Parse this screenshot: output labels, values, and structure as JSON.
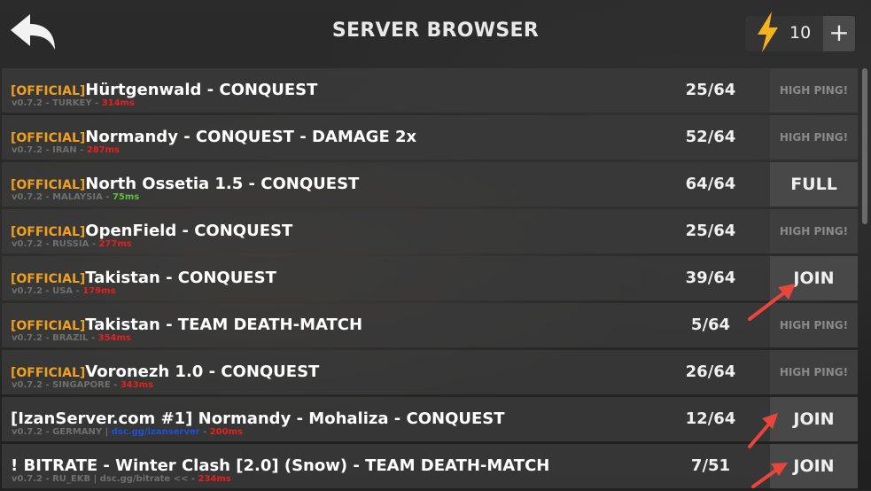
{
  "header": {
    "title": "SERVER BROWSER",
    "energy_count": "10",
    "plus_label": "+",
    "back_icon": "back-arrow-icon",
    "energy_icon": "lightning-bolt-icon"
  },
  "colors": {
    "official_tag": "#f0a020",
    "ping_red": "#e52020",
    "ping_green": "#5cc23a",
    "link_blue": "#1f4fd8"
  },
  "servers": [
    {
      "tag": "[OFFICIAL]",
      "name": "Hürtgenwald - CONQUEST",
      "meta": "v0.7.2 - TURKEY - ",
      "link": "",
      "link_suffix": "",
      "ping": "314ms",
      "ping_color": "#e52020",
      "players": "25/64",
      "action": "HIGH PING!",
      "action_type": "high"
    },
    {
      "tag": "[OFFICIAL]",
      "name": "Normandy - CONQUEST - DAMAGE 2x",
      "meta": "v0.7.2 - IRAN - ",
      "link": "",
      "link_suffix": "",
      "ping": "287ms",
      "ping_color": "#e52020",
      "players": "52/64",
      "action": "HIGH PING!",
      "action_type": "high"
    },
    {
      "tag": "[OFFICIAL]",
      "name": "North Ossetia 1.5 - CONQUEST",
      "meta": "v0.7.2 - MALAYSIA - ",
      "link": "",
      "link_suffix": "",
      "ping": "75ms",
      "ping_color": "#5cc23a",
      "players": "64/64",
      "action": "FULL",
      "action_type": "full"
    },
    {
      "tag": "[OFFICIAL]",
      "name": "OpenField - CONQUEST",
      "meta": "v0.7.2 - RUSSIA - ",
      "link": "",
      "link_suffix": "",
      "ping": "277ms",
      "ping_color": "#e52020",
      "players": "25/64",
      "action": "HIGH PING!",
      "action_type": "high"
    },
    {
      "tag": "[OFFICIAL]",
      "name": "Takistan - CONQUEST",
      "meta": "v0.7.2 - USA - ",
      "link": "",
      "link_suffix": "",
      "ping": "179ms",
      "ping_color": "#e52020",
      "players": "39/64",
      "action": "JOIN",
      "action_type": "join"
    },
    {
      "tag": "[OFFICIAL]",
      "name": "Takistan - TEAM DEATH-MATCH",
      "meta": "v0.7.2 - BRAZIL - ",
      "link": "",
      "link_suffix": "",
      "ping": "354ms",
      "ping_color": "#e52020",
      "players": "5/64",
      "action": "HIGH PING!",
      "action_type": "high"
    },
    {
      "tag": "[OFFICIAL]",
      "name": "Voronezh 1.0 - CONQUEST",
      "meta": "v0.7.2 - SINGAPORE - ",
      "link": "",
      "link_suffix": "",
      "ping": "343ms",
      "ping_color": "#e52020",
      "players": "26/64",
      "action": "HIGH PING!",
      "action_type": "high"
    },
    {
      "tag": "",
      "name": " [IzanServer.com #1] Normandy - Mohaliza - CONQUEST",
      "meta": "v0.7.2 - GERMANY | ",
      "link": "dsc.gg/izanserver",
      "link_suffix": " - ",
      "ping": "200ms",
      "ping_color": "#e52020",
      "players": "12/64",
      "action": "JOIN",
      "action_type": "join"
    },
    {
      "tag": "",
      "name": "! BITRATE - Winter Clash [2.0] (Snow) - TEAM DEATH-MATCH",
      "meta": "v0.7.2 - RU_EKB | dsc.gg/bitrate << - ",
      "link": "",
      "link_suffix": "",
      "ping": "234ms",
      "ping_color": "#e52020",
      "players": "7/51",
      "action": "JOIN",
      "action_type": "join"
    }
  ]
}
